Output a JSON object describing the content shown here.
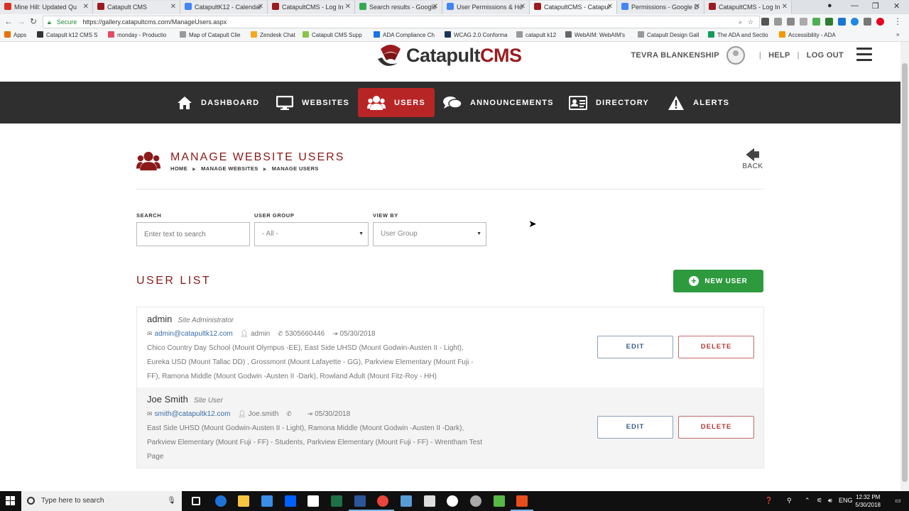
{
  "browser": {
    "tabs": [
      {
        "label": "Mine Hill: Updated Qu",
        "color": "#d93025"
      },
      {
        "label": "Catapult CMS",
        "color": "#9a1b1f"
      },
      {
        "label": "CatapultK12 - Calendar",
        "color": "#4285f4"
      },
      {
        "label": "CatapultCMS - Log In",
        "color": "#9a1b1f"
      },
      {
        "label": "Search results - Google",
        "color": "#34a853"
      },
      {
        "label": "User Permissions & Ho",
        "color": "#4285f4"
      },
      {
        "label": "CatapultCMS - Catapul",
        "color": "#9a1b1f"
      },
      {
        "label": "Permissions - Google D",
        "color": "#4285f4"
      },
      {
        "label": "CatapultCMS - Log In",
        "color": "#9a1b1f"
      }
    ],
    "secure_label": "Secure",
    "url": "https://gallery.catapultcms.com/ManageUsers.aspx",
    "bookmarks": [
      {
        "label": "Apps",
        "color": "#e8710a"
      },
      {
        "label": "Catapult k12 CMS S",
        "color": "#333333"
      },
      {
        "label": "monday - Productio",
        "color": "#e44c65"
      },
      {
        "label": "Map of Catapult Clie",
        "color": "#999999"
      },
      {
        "label": "Zendesk Chat",
        "color": "#f5a623"
      },
      {
        "label": "Catapult CMS Supp",
        "color": "#8bc34a"
      },
      {
        "label": "ADA Compliance Ch",
        "color": "#1a73e8"
      },
      {
        "label": "WCAG 2.0 Conforma",
        "color": "#1d3557"
      },
      {
        "label": "catapult k12",
        "color": "#999999"
      },
      {
        "label": "WebAIM: WebAIM's",
        "color": "#666666"
      },
      {
        "label": "Catapult Design Gall",
        "color": "#999999"
      },
      {
        "label": "The ADA and Sectio",
        "color": "#0f9d58"
      },
      {
        "label": "Accessibility - ADA",
        "color": "#f29900"
      }
    ]
  },
  "header": {
    "logo_catapult": "Catapult",
    "logo_cms": "CMS",
    "username": "TEVRA BLANKENSHIP",
    "help": "HELP",
    "logout": "LOG OUT",
    "separator": "|"
  },
  "nav": [
    {
      "label": "DASHBOARD",
      "icon": "home-icon"
    },
    {
      "label": "WEBSITES",
      "icon": "monitor-icon"
    },
    {
      "label": "USERS",
      "icon": "users-icon",
      "active": true
    },
    {
      "label": "ANNOUNCEMENTS",
      "icon": "chat-icon"
    },
    {
      "label": "DIRECTORY",
      "icon": "id-card-icon"
    },
    {
      "label": "ALERTS",
      "icon": "warning-icon"
    }
  ],
  "page": {
    "title": "MANAGE WEBSITE USERS",
    "breadcrumb": [
      "HOME",
      "MANAGE WEBSITES",
      "MANAGE USERS"
    ],
    "back": "BACK"
  },
  "filters": {
    "search_label": "SEARCH",
    "search_placeholder": "Enter text to search",
    "group_label": "USER GROUP",
    "group_value": "- All -",
    "view_label": "VIEW BY",
    "view_value": "User Group"
  },
  "list": {
    "title": "USER LIST",
    "new_user": "NEW USER",
    "edit": "EDIT",
    "delete": "DELETE",
    "users": [
      {
        "name": "admin",
        "role": "Site Administrator",
        "email": "admin@catapultk12.com",
        "username": "admin",
        "phone": "5305660446",
        "last_login": "05/30/2018",
        "sites": "Chico Country Day School (Mount Olympus -EE), East Side UHSD (Mount Godwin-Austen II - Light), Eureka USD (Mount Tallac DD) , Grossmont (Mount Lafayette - GG), Parkview Elementary (Mount Fuji - FF), Ramona Middle (Mount Godwin -Austen II -Dark), Rowland Adult (Mount Fitz-Roy - HH)"
      },
      {
        "name": "Joe Smith",
        "role": "Site User",
        "email": "smith@catapultk12.com",
        "username": "Joe.smith",
        "phone": "",
        "last_login": "05/30/2018",
        "sites": "East Side UHSD (Mount Godwin-Austen II - Light), Ramona Middle (Mount Godwin -Austen II -Dark), Parkview Elementary (Mount Fuji - FF) - Students, Parkview Elementary (Mount Fuji - FF) - Wrentham Test Page"
      }
    ]
  },
  "taskbar": {
    "search_placeholder": "Type here to search",
    "language": "ENG",
    "time": "12:32 PM",
    "date": "5/30/2018"
  },
  "colors": {
    "brand_red": "#9a1b1f",
    "nav_active": "#b82525",
    "nav_bg": "#2f2f2f",
    "new_user_green": "#2d9a3e"
  }
}
